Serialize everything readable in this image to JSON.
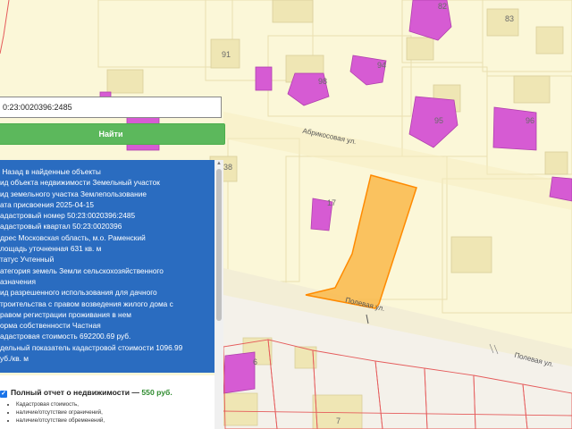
{
  "map": {
    "plot_labels": [
      "82",
      "83",
      "91",
      "94",
      "95",
      "96",
      "98",
      "38",
      "17",
      "6",
      "7"
    ],
    "streets": [
      "Абрикосовая ул.",
      "Полевая ул.",
      "Полевая ул."
    ],
    "colors": {
      "background": "#fbf7d8",
      "building_pink": "#d65bd3",
      "building_beige": "#efe6b4",
      "selected_parcel": "#f9b84a",
      "parcel_outline": "#ff8a00",
      "red_outline": "#e55b5b"
    }
  },
  "search": {
    "value": "0:23:0020396:2485",
    "button_label": "Найти"
  },
  "panel": {
    "back_link": "Назад в найденные объекты",
    "rows": [
      {
        "key": "ид объекта недвижимости",
        "value": "Земельный участок"
      },
      {
        "key": "ид земельного участка",
        "value": "Землепользование"
      },
      {
        "key": "ата присвоения",
        "value": "2025-04-15"
      },
      {
        "key": "адастровый номер",
        "value": "50:23:0020396:2485"
      },
      {
        "key": "адастровый квартал",
        "value": "50:23:0020396"
      },
      {
        "key": "дрес",
        "value": "Московская область, м.о. Раменский"
      },
      {
        "key": "лощадь уточненная",
        "value": "631 кв. м"
      },
      {
        "key": "татус",
        "value": "Учтенный"
      },
      {
        "key": "атегория земель",
        "value": "Земли сельскохозяйственного"
      },
      {
        "key": "",
        "value": "азначения"
      },
      {
        "key": "ид разрешенного использования",
        "value": "для дачного"
      },
      {
        "key": "",
        "value": "троительства с правом возведения жилого дома с"
      },
      {
        "key": "",
        "value": "равом регистрации проживания в нем"
      },
      {
        "key": "орма собственности",
        "value": "Частная"
      },
      {
        "key": "адастровая стоимость",
        "value": "692200.69 руб."
      },
      {
        "key": "дельный показатель кадастровой стоимости",
        "value": "1096.99"
      },
      {
        "key": "",
        "value": "уб./кв. м"
      }
    ]
  },
  "report": {
    "checkbox": "✓",
    "title": "Полный отчет о недвижимости —",
    "price": "550 руб.",
    "items": [
      "Кадастровая стоимость,",
      "наличие/отсутствие ограничений,",
      "наличие/отсутствие обременений,"
    ]
  }
}
